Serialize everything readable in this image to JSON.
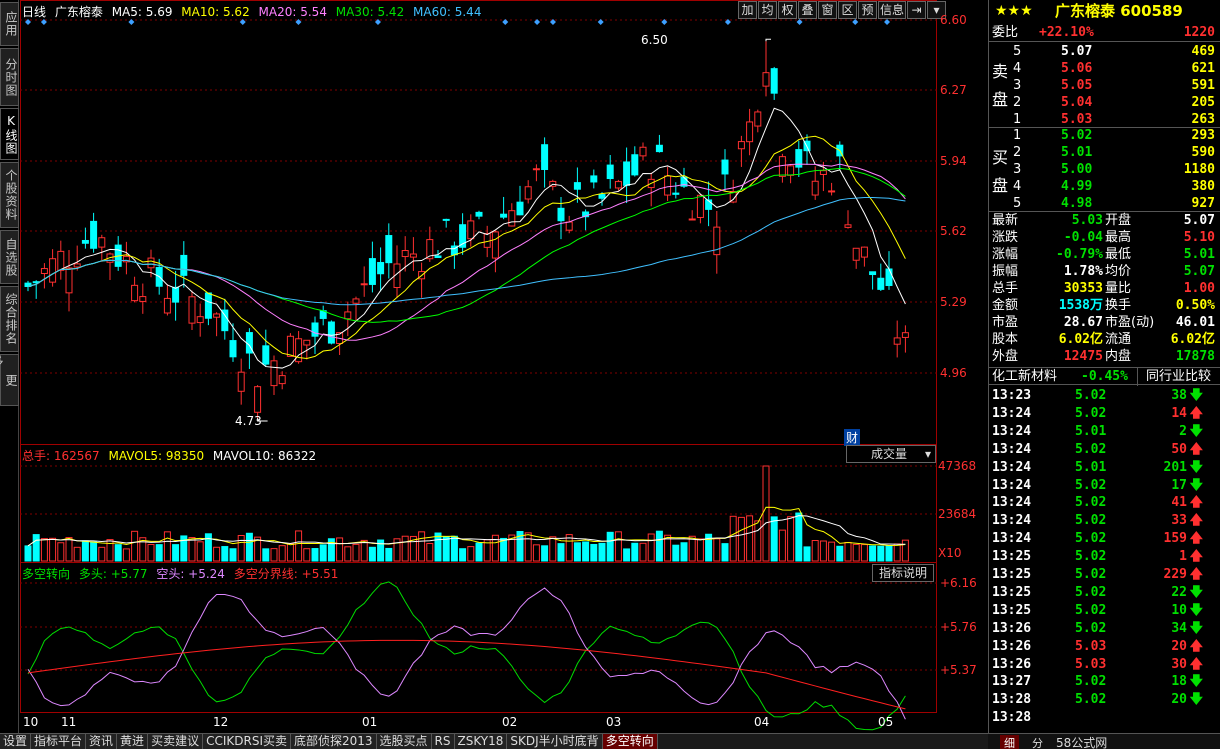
{
  "left_tabs": [
    {
      "label": "应用"
    },
    {
      "label": "分时图"
    },
    {
      "label": "K线图",
      "active": true
    },
    {
      "label": "个股资料"
    },
    {
      "label": "自选股"
    },
    {
      "label": "综合排名"
    },
    {
      "label": "更多..."
    }
  ],
  "kline_legend": {
    "period": "日线",
    "stock": "广东榕泰",
    "ma5": "MA5: 5.69",
    "ma10": "MA10: 5.62",
    "ma20": "MA20: 5.54",
    "ma30": "MA30: 5.42",
    "ma60": "MA60: 5.44"
  },
  "toolbar": [
    "加",
    "均",
    "权",
    "叠",
    "窗",
    "区",
    "预",
    "信息",
    "⇥"
  ],
  "price_axis": [
    "6.60",
    "6.27",
    "5.94",
    "5.62",
    "5.29",
    "4.96"
  ],
  "annotations": {
    "high": "6.50",
    "low": "4.73",
    "fin": "财"
  },
  "volume_legend": {
    "total": "总手: 162567",
    "mavol5": "MAVOL5: 98350",
    "mavol10": "MAVOL10: 86322"
  },
  "volume_dropdown": "成交量",
  "volume_axis": [
    "47368",
    "23684",
    "X10"
  ],
  "indicator_legend": {
    "name": "多空转向",
    "long": "多头: +5.77",
    "short": "空头: +5.24",
    "line": "多空分界线: +5.51"
  },
  "indicator_button": "指标说明",
  "indicator_axis": [
    "+6.16",
    "+5.76",
    "+5.37"
  ],
  "month_axis": [
    "10",
    "11",
    "12",
    "01",
    "02",
    "03",
    "04",
    "05"
  ],
  "chart_data": {
    "type": "candlestick",
    "price_range": [
      4.73,
      6.6
    ],
    "high": 6.5,
    "low": 4.73,
    "volume_max": 47368,
    "indicator_range": [
      5.17,
      6.16
    ],
    "colors": {
      "up": "#ff3030",
      "down": "#00ffff",
      "ma5": "#ffffff",
      "ma10": "#ffff00",
      "ma20": "#ff80ff",
      "ma30": "#00ff00",
      "ma60": "#40c0ff",
      "long": "#00dd00",
      "short": "#dd88ff",
      "boundary": "#ff2020"
    }
  },
  "quote": {
    "title": "广东榕泰 600589",
    "wb_label": "委比",
    "wb_value": "+22.10%",
    "wb_diff": "1220",
    "sell_label": "卖盘",
    "buy_label": "买盘",
    "sell": [
      {
        "lvl": "5",
        "price": "5.07",
        "vol": "469"
      },
      {
        "lvl": "4",
        "price": "5.06",
        "vol": "621"
      },
      {
        "lvl": "3",
        "price": "5.05",
        "vol": "591"
      },
      {
        "lvl": "2",
        "price": "5.04",
        "vol": "205"
      },
      {
        "lvl": "1",
        "price": "5.03",
        "vol": "263"
      }
    ],
    "buy": [
      {
        "lvl": "1",
        "price": "5.02",
        "vol": "293"
      },
      {
        "lvl": "2",
        "price": "5.01",
        "vol": "590"
      },
      {
        "lvl": "3",
        "price": "5.00",
        "vol": "1180"
      },
      {
        "lvl": "4",
        "price": "4.99",
        "vol": "380"
      },
      {
        "lvl": "5",
        "price": "4.98",
        "vol": "927"
      }
    ],
    "stats": [
      {
        "l1": "最新",
        "v1": "5.03",
        "c1": "green",
        "l2": "开盘",
        "v2": "5.07",
        "c2": "white"
      },
      {
        "l1": "涨跌",
        "v1": "-0.04",
        "c1": "green",
        "l2": "最高",
        "v2": "5.10",
        "c2": "red"
      },
      {
        "l1": "涨幅",
        "v1": "-0.79%",
        "c1": "green",
        "l2": "最低",
        "v2": "5.01",
        "c2": "green"
      },
      {
        "l1": "振幅",
        "v1": "1.78%",
        "c1": "white",
        "l2": "均价",
        "v2": "5.07",
        "c2": "green"
      },
      {
        "l1": "总手",
        "v1": "30353",
        "c1": "yellow",
        "l2": "量比",
        "v2": "1.00",
        "c2": "red"
      },
      {
        "l1": "金额",
        "v1": "1538万",
        "c1": "cyan",
        "l2": "换手",
        "v2": "0.50%",
        "c2": "yellow"
      },
      {
        "l1": "市盈",
        "v1": "28.67",
        "c1": "white",
        "l2": "市盈(动)",
        "v2": "46.01",
        "c2": "white"
      },
      {
        "l1": "股本",
        "v1": "6.02亿",
        "c1": "yellow",
        "l2": "流通",
        "v2": "6.02亿",
        "c2": "yellow"
      },
      {
        "l1": "外盘",
        "v1": "12475",
        "c1": "red",
        "l2": "内盘",
        "v2": "17878",
        "c2": "green"
      }
    ],
    "industry": {
      "name": "化工新材料",
      "change": "-0.45%",
      "button": "同行业比较"
    },
    "ticks": [
      {
        "t": "13:23",
        "p": "5.02",
        "v": "38",
        "d": "down"
      },
      {
        "t": "13:24",
        "p": "5.02",
        "v": "14",
        "d": "up"
      },
      {
        "t": "13:24",
        "p": "5.01",
        "v": "2",
        "d": "down"
      },
      {
        "t": "13:24",
        "p": "5.02",
        "v": "50",
        "d": "up"
      },
      {
        "t": "13:24",
        "p": "5.01",
        "v": "201",
        "d": "down"
      },
      {
        "t": "13:24",
        "p": "5.02",
        "v": "17",
        "d": "down"
      },
      {
        "t": "13:24",
        "p": "5.02",
        "v": "41",
        "d": "up"
      },
      {
        "t": "13:24",
        "p": "5.02",
        "v": "33",
        "d": "up"
      },
      {
        "t": "13:24",
        "p": "5.02",
        "v": "159",
        "d": "up"
      },
      {
        "t": "13:25",
        "p": "5.02",
        "v": "1",
        "d": "up"
      },
      {
        "t": "13:25",
        "p": "5.02",
        "v": "229",
        "d": "up"
      },
      {
        "t": "13:25",
        "p": "5.02",
        "v": "22",
        "d": "down"
      },
      {
        "t": "13:25",
        "p": "5.02",
        "v": "10",
        "d": "down"
      },
      {
        "t": "13:26",
        "p": "5.02",
        "v": "34",
        "d": "down"
      },
      {
        "t": "13:26",
        "p": "5.03",
        "v": "20",
        "d": "up"
      },
      {
        "t": "13:26",
        "p": "5.03",
        "v": "30",
        "d": "up"
      },
      {
        "t": "13:27",
        "p": "5.02",
        "v": "18",
        "d": "down"
      },
      {
        "t": "13:28",
        "p": "5.02",
        "v": "20",
        "d": "down"
      },
      {
        "t": "13:28",
        "p": "",
        "v": "",
        "d": ""
      }
    ],
    "bottom_tabs": [
      "细",
      "分"
    ]
  },
  "bottom_tabs": [
    "设置",
    "指标平台",
    "资讯",
    "黄进",
    "买卖建议",
    "CCIKDRSI买卖",
    "底部侦探2013",
    "选股买点",
    "RS",
    "ZSKY18",
    "SKDJ半小时底背",
    "多空转向"
  ]
}
